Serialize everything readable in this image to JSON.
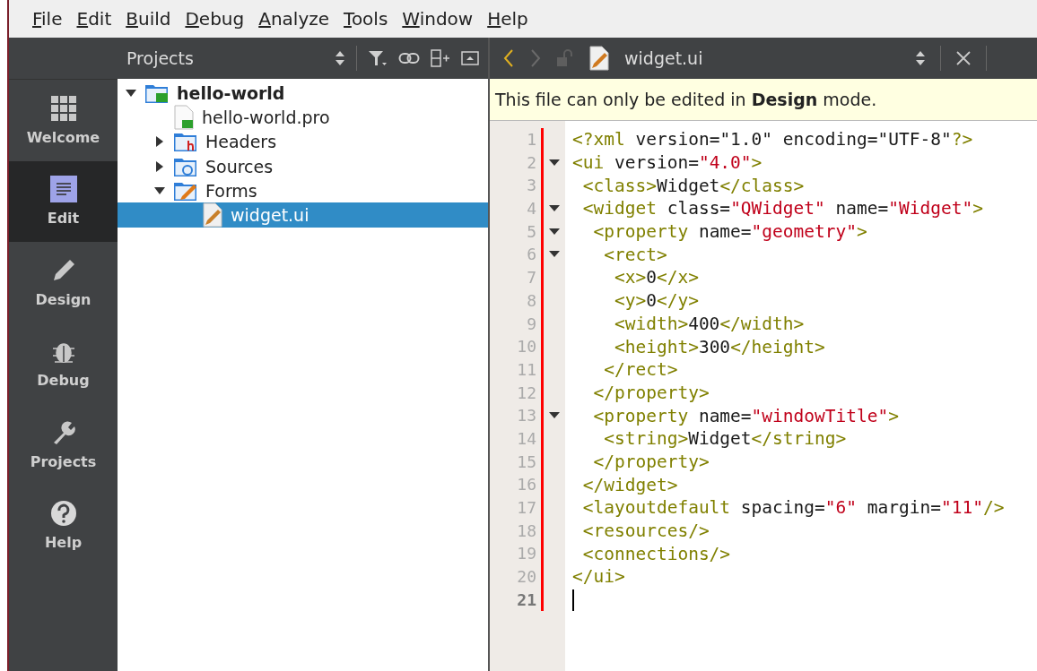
{
  "menu": [
    "File",
    "Edit",
    "Build",
    "Debug",
    "Analyze",
    "Tools",
    "Window",
    "Help"
  ],
  "modes": [
    {
      "label": "Welcome",
      "kind": "grid",
      "selected": false
    },
    {
      "label": "Edit",
      "kind": "edit",
      "selected": true
    },
    {
      "label": "Design",
      "kind": "pencil",
      "selected": false
    },
    {
      "label": "Debug",
      "kind": "bug",
      "selected": false
    },
    {
      "label": "Projects",
      "kind": "wrench",
      "selected": false
    },
    {
      "label": "Help",
      "kind": "help",
      "selected": false
    }
  ],
  "projects_panel": {
    "title": "Projects",
    "tree": [
      {
        "label": "hello-world",
        "kind": "project",
        "expanded": true,
        "selected": false,
        "children": [
          {
            "label": "hello-world.pro",
            "kind": "pro",
            "selected": false
          },
          {
            "label": "Headers",
            "kind": "headers",
            "expanded": false,
            "selected": false
          },
          {
            "label": "Sources",
            "kind": "sources",
            "expanded": false,
            "selected": false
          },
          {
            "label": "Forms",
            "kind": "forms",
            "expanded": true,
            "selected": false,
            "children": [
              {
                "label": "widget.ui",
                "kind": "ui",
                "selected": true
              }
            ]
          }
        ]
      }
    ]
  },
  "editor": {
    "file_name": "widget.ui",
    "info": "This file can only be edited in **Design** mode.",
    "lines": [
      {
        "number": "1",
        "fold": false,
        "current": false,
        "tokens": [
          {
            "kind": "tag",
            "text": "<?xml "
          },
          {
            "kind": "attr",
            "text": "version="
          },
          {
            "kind": "text",
            "text": "\"1.0\" "
          },
          {
            "kind": "attr",
            "text": "encoding="
          },
          {
            "kind": "text",
            "text": "\"UTF-8\""
          },
          {
            "kind": "tag",
            "text": "?>"
          }
        ]
      },
      {
        "number": "2",
        "fold": true,
        "current": false,
        "tokens": [
          {
            "kind": "tag",
            "text": "<ui "
          },
          {
            "kind": "attr",
            "text": "version="
          },
          {
            "kind": "str",
            "text": "\"4.0\""
          },
          {
            "kind": "tag",
            "text": ">"
          }
        ]
      },
      {
        "number": "3",
        "fold": false,
        "current": false,
        "tokens": [
          {
            "kind": "tag",
            "text": " <class>"
          },
          {
            "kind": "text",
            "text": "Widget"
          },
          {
            "kind": "tag",
            "text": "</class>"
          }
        ]
      },
      {
        "number": "4",
        "fold": true,
        "current": false,
        "tokens": [
          {
            "kind": "tag",
            "text": " <widget "
          },
          {
            "kind": "attr",
            "text": "class="
          },
          {
            "kind": "str",
            "text": "\"QWidget\" "
          },
          {
            "kind": "attr",
            "text": "name="
          },
          {
            "kind": "str",
            "text": "\"Widget\""
          },
          {
            "kind": "tag",
            "text": ">"
          }
        ]
      },
      {
        "number": "5",
        "fold": true,
        "current": false,
        "tokens": [
          {
            "kind": "tag",
            "text": "  <property "
          },
          {
            "kind": "attr",
            "text": "name="
          },
          {
            "kind": "str",
            "text": "\"geometry\""
          },
          {
            "kind": "tag",
            "text": ">"
          }
        ]
      },
      {
        "number": "6",
        "fold": true,
        "current": false,
        "tokens": [
          {
            "kind": "tag",
            "text": "   <rect>"
          }
        ]
      },
      {
        "number": "7",
        "fold": false,
        "current": false,
        "tokens": [
          {
            "kind": "tag",
            "text": "    <x>"
          },
          {
            "kind": "text",
            "text": "0"
          },
          {
            "kind": "tag",
            "text": "</x>"
          }
        ]
      },
      {
        "number": "8",
        "fold": false,
        "current": false,
        "tokens": [
          {
            "kind": "tag",
            "text": "    <y>"
          },
          {
            "kind": "text",
            "text": "0"
          },
          {
            "kind": "tag",
            "text": "</y>"
          }
        ]
      },
      {
        "number": "9",
        "fold": false,
        "current": false,
        "tokens": [
          {
            "kind": "tag",
            "text": "    <width>"
          },
          {
            "kind": "text",
            "text": "400"
          },
          {
            "kind": "tag",
            "text": "</width>"
          }
        ]
      },
      {
        "number": "10",
        "fold": false,
        "current": false,
        "tokens": [
          {
            "kind": "tag",
            "text": "    <height>"
          },
          {
            "kind": "text",
            "text": "300"
          },
          {
            "kind": "tag",
            "text": "</height>"
          }
        ]
      },
      {
        "number": "11",
        "fold": false,
        "current": false,
        "tokens": [
          {
            "kind": "tag",
            "text": "   </rect>"
          }
        ]
      },
      {
        "number": "12",
        "fold": false,
        "current": false,
        "tokens": [
          {
            "kind": "tag",
            "text": "  </property>"
          }
        ]
      },
      {
        "number": "13",
        "fold": true,
        "current": false,
        "tokens": [
          {
            "kind": "tag",
            "text": "  <property "
          },
          {
            "kind": "attr",
            "text": "name="
          },
          {
            "kind": "str",
            "text": "\"windowTitle\""
          },
          {
            "kind": "tag",
            "text": ">"
          }
        ]
      },
      {
        "number": "14",
        "fold": false,
        "current": false,
        "tokens": [
          {
            "kind": "tag",
            "text": "   <string>"
          },
          {
            "kind": "text",
            "text": "Widget"
          },
          {
            "kind": "tag",
            "text": "</string>"
          }
        ]
      },
      {
        "number": "15",
        "fold": false,
        "current": false,
        "tokens": [
          {
            "kind": "tag",
            "text": "  </property>"
          }
        ]
      },
      {
        "number": "16",
        "fold": false,
        "current": false,
        "tokens": [
          {
            "kind": "tag",
            "text": " </widget>"
          }
        ]
      },
      {
        "number": "17",
        "fold": false,
        "current": false,
        "tokens": [
          {
            "kind": "tag",
            "text": " <layoutdefault "
          },
          {
            "kind": "attr",
            "text": "spacing="
          },
          {
            "kind": "str",
            "text": "\"6\" "
          },
          {
            "kind": "attr",
            "text": "margin="
          },
          {
            "kind": "str",
            "text": "\"11\""
          },
          {
            "kind": "tag",
            "text": "/>"
          }
        ]
      },
      {
        "number": "18",
        "fold": false,
        "current": false,
        "tokens": [
          {
            "kind": "tag",
            "text": " <resources/>"
          }
        ]
      },
      {
        "number": "19",
        "fold": false,
        "current": false,
        "tokens": [
          {
            "kind": "tag",
            "text": " <connections/>"
          }
        ]
      },
      {
        "number": "20",
        "fold": false,
        "current": false,
        "tokens": [
          {
            "kind": "tag",
            "text": "</ui>"
          }
        ]
      },
      {
        "number": "21",
        "fold": false,
        "current": true
      }
    ]
  }
}
